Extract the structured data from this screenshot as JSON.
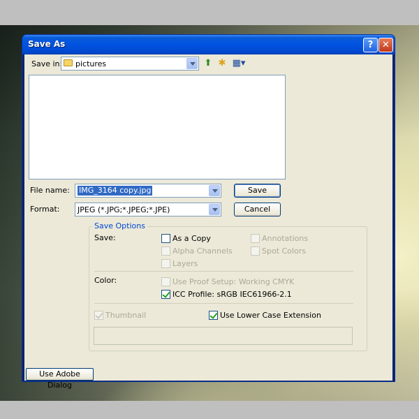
{
  "window": {
    "title": "Save As",
    "help_label": "?",
    "close_label": "✕"
  },
  "save_in": {
    "label": "Save in:",
    "value": "pictures",
    "tools": [
      "up-folder-icon",
      "new-folder-icon",
      "view-menu-icon"
    ]
  },
  "file_name": {
    "label": "File name:",
    "value": "IMG_3164 copy.jpg"
  },
  "format": {
    "label": "Format:",
    "value": "JPEG (*.JPG;*.JPEG;*.JPE)"
  },
  "buttons": {
    "save": "Save",
    "cancel": "Cancel",
    "adobe_dialog": "Use Adobe Dialog"
  },
  "save_options": {
    "title": "Save Options",
    "save_label": "Save:",
    "as_a_copy": {
      "label": "As a Copy",
      "checked": false,
      "enabled": true
    },
    "annotations": {
      "label": "Annotations",
      "checked": false,
      "enabled": false
    },
    "alpha_channels": {
      "label": "Alpha Channels",
      "checked": false,
      "enabled": false
    },
    "spot_colors": {
      "label": "Spot Colors",
      "checked": false,
      "enabled": false
    },
    "layers": {
      "label": "Layers",
      "checked": false,
      "enabled": false
    },
    "color_label": "Color:",
    "use_proof_setup": {
      "label": "Use Proof Setup:  Working CMYK",
      "checked": false,
      "enabled": false
    },
    "icc_profile": {
      "label": "ICC Profile:  sRGB IEC61966-2.1",
      "checked": true,
      "enabled": true
    },
    "thumbnail": {
      "label": "Thumbnail",
      "checked": true,
      "enabled": false
    },
    "lower_case_ext": {
      "label": "Use Lower Case Extension",
      "checked": true,
      "enabled": true
    }
  },
  "colors": {
    "titlebar": "#0053e1",
    "dialog_bg": "#ece9d8",
    "group_title": "#0046d5",
    "selection": "#316ac5"
  }
}
